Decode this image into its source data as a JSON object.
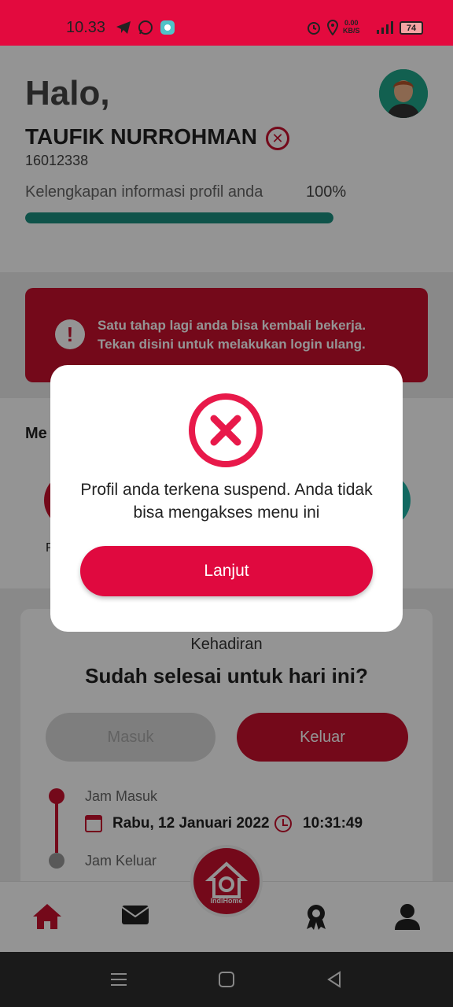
{
  "status_bar": {
    "time": "10.33",
    "net_speed_value": "0.00",
    "net_speed_unit": "KB/S",
    "battery": "74"
  },
  "header": {
    "greeting": "Halo,",
    "user_name": "TAUFIK NURROHMAN",
    "user_id": "16012338",
    "completeness_label": "Kelengkapan informasi profil anda",
    "completeness_percent_text": "100%",
    "completeness_fraction": 1.0
  },
  "alert": {
    "line1": "Satu tahap lagi anda bisa kembali bekerja.",
    "line2": "Tekan disini untuk melakukan login ulang."
  },
  "menu": {
    "title_partial": "Me",
    "left_item_label_partial": "P"
  },
  "attendance": {
    "label": "Kehadiran",
    "title": "Sudah selesai untuk hari ini?",
    "masuk_button": "Masuk",
    "keluar_button": "Keluar",
    "jam_masuk_label": "Jam Masuk",
    "date": "Rabu, 12 Januari 2022",
    "time": "10:31:49",
    "jam_keluar_label": "Jam Keluar"
  },
  "fab": {
    "brand": "IndiHome"
  },
  "dialog": {
    "message": "Profil anda terkena suspend. Anda tidak bisa mengakses menu ini",
    "button": "Lanjut"
  },
  "colors": {
    "status_bar": "#e30a3e",
    "brand_red": "#c8102e",
    "dialog_button": "#e0093f",
    "progress": "#1b8f80"
  }
}
